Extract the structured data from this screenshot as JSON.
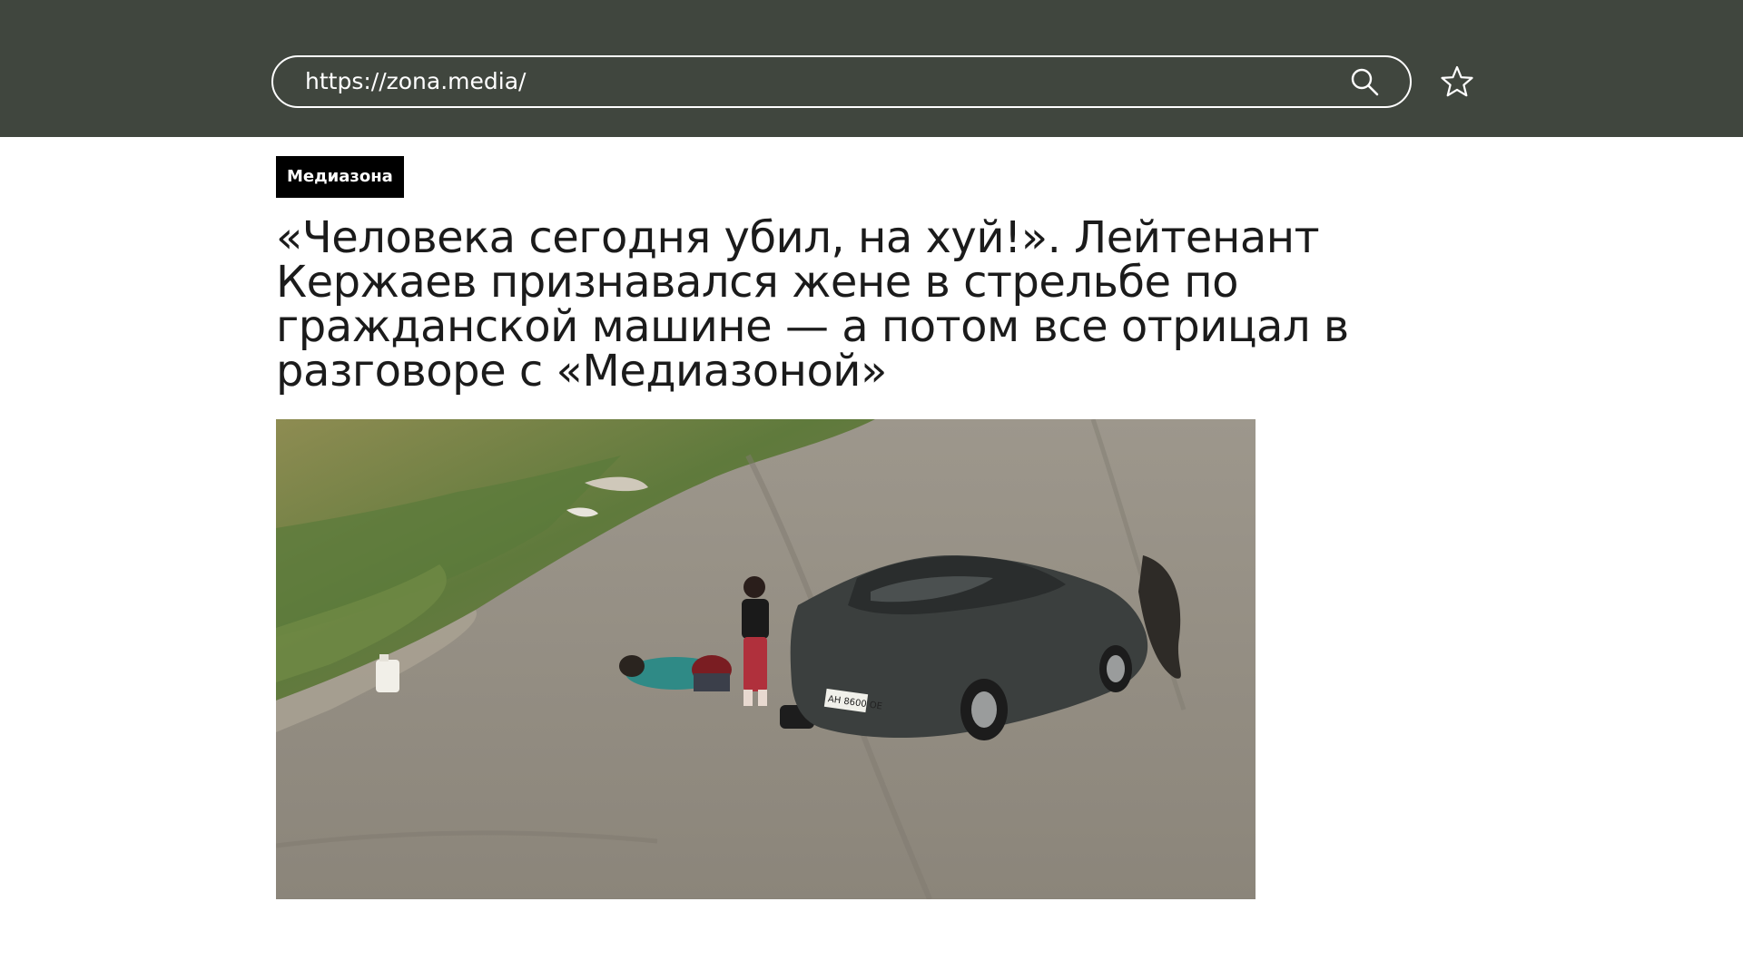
{
  "browser": {
    "url": "https://zona.media/",
    "search_icon": "search-icon",
    "bookmark_icon": "star-icon"
  },
  "article": {
    "source_badge": "Медиазона",
    "headline": "«Человека сегодня убил, на хуй!». Лейтенант Кержаев признавался жене в стрельбе по гражданской машине — а потом все отрицал в разговоре с «Медиазоной»",
    "photo": {
      "license_plate": "AH 8600 OE"
    }
  },
  "colors": {
    "topbar": "#40463e",
    "badge_bg": "#000000",
    "badge_text": "#ffffff",
    "headline_text": "#1b1b1b"
  }
}
